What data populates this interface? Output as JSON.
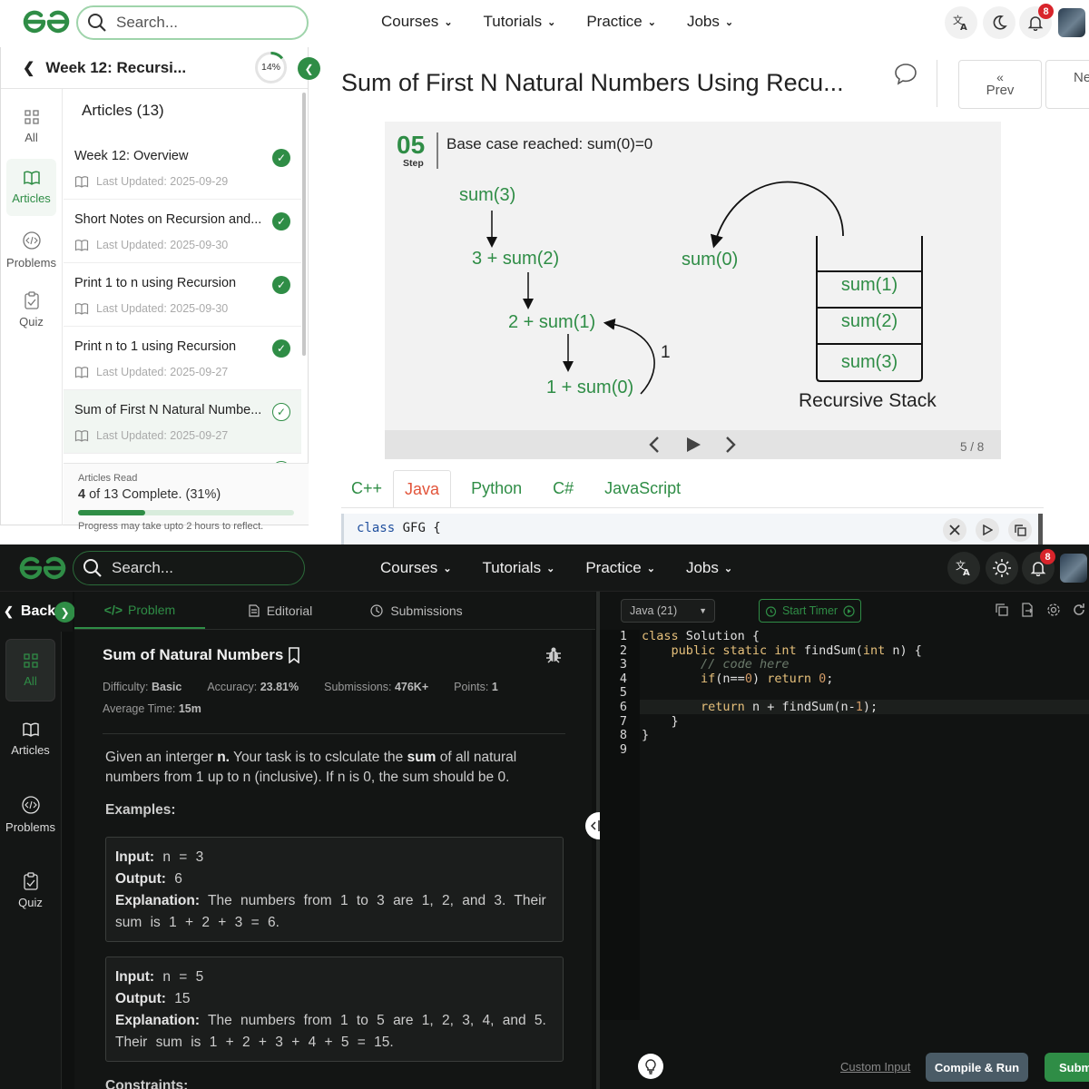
{
  "top": {
    "search_placeholder": "Search...",
    "nav": [
      "Courses",
      "Tutorials",
      "Practice",
      "Jobs"
    ],
    "notification_count": "8",
    "sidebar": {
      "back_title": "Week 12: Recursi...",
      "progress_label": "14%",
      "progress_value": 0.14,
      "rail": [
        {
          "label": "All",
          "icon": "grid-icon"
        },
        {
          "label": "Articles",
          "icon": "book-icon"
        },
        {
          "label": "Problems",
          "icon": "code-icon"
        },
        {
          "label": "Quiz",
          "icon": "clipboard-icon"
        }
      ],
      "section_title": "Articles (13)",
      "articles": [
        {
          "title": "Week 12: Overview",
          "updated": "Last Updated: 2025-09-29"
        },
        {
          "title": "Short Notes on Recursion and...",
          "updated": "Last Updated: 2025-09-30"
        },
        {
          "title": "Print 1 to n using Recursion",
          "updated": "Last Updated: 2025-09-30"
        },
        {
          "title": "Print n to 1 using Recursion",
          "updated": "Last Updated: 2025-09-27"
        },
        {
          "title": "Sum of First N Natural Numbe...",
          "updated": "Last Updated: 2025-09-27"
        }
      ],
      "articles_read_label": "Articles Read",
      "complete_count": "4",
      "complete_rest": "of 13 Complete. (31%)",
      "complete_value": 0.31,
      "progress_note": "Progress may take upto 2 hours to reflect."
    },
    "page_title": "Sum of First N Natural Numbers Using Recu...",
    "prev_label": "Prev",
    "next_label": "Ne",
    "slide": {
      "step_number": "05",
      "step_label": "Step",
      "caption": "Base case reached: sum(0)=0",
      "calls": [
        "sum(3)",
        "3 + sum(2)",
        "2 + sum(1)",
        "1 + sum(0)"
      ],
      "returned": "sum(0)",
      "return_value": "1",
      "stack": [
        "sum(1)",
        "sum(2)",
        "sum(3)"
      ],
      "stack_title": "Recursive Stack",
      "counter": "5 / 8"
    },
    "lang_tabs": [
      "C++",
      "Java",
      "Python",
      "C#",
      "JavaScript"
    ],
    "active_lang": "Java",
    "code_line": [
      "class",
      " GFG {"
    ]
  },
  "bottom": {
    "search_placeholder": "Search...",
    "nav": [
      "Courses",
      "Tutorials",
      "Practice",
      "Jobs"
    ],
    "notification_count": "8",
    "back_label": "Back",
    "tabs": [
      "Problem",
      "Editorial",
      "Submissions"
    ],
    "rail": [
      {
        "label": "All",
        "icon": "grid-icon"
      },
      {
        "label": "Articles",
        "icon": "book-icon"
      },
      {
        "label": "Problems",
        "icon": "code-icon"
      },
      {
        "label": "Quiz",
        "icon": "clipboard-icon"
      }
    ],
    "problem_title": "Sum of Natural Numbers",
    "meta": {
      "difficulty_label": "Difficulty:",
      "difficulty": "Basic",
      "accuracy_label": "Accuracy:",
      "accuracy": "23.81%",
      "submissions_label": "Submissions:",
      "submissions": "476K+",
      "points_label": "Points:",
      "points": "1",
      "avg_time_label": "Average Time:",
      "avg_time": "15m"
    },
    "statement": {
      "p1": "Given an interger ",
      "n": "n.",
      "p2": " Your task is to cslculate the ",
      "sum": "sum",
      "p3": " of all natural numbers from 1 up to n (inclusive). If n is 0, the sum should be 0."
    },
    "examples_heading": "Examples:",
    "examples": [
      {
        "input": "n = 3",
        "output": "6",
        "explanation": "The numbers from 1 to 3 are 1, 2, and 3. Their sum is 1 + 2 + 3 = 6."
      },
      {
        "input": "n = 5",
        "output": "15",
        "explanation": "The numbers from 1 to 5 are 1, 2, 3, 4, and 5. Their sum is 1 + 2 + 3 + 4 + 5 = 15."
      }
    ],
    "input_label": "Input:",
    "output_label": "Output:",
    "explanation_label": "Explanation:",
    "constraints_heading": "Constraints:",
    "language": "Java (21)",
    "start_timer": "Start Timer",
    "line_numbers": [
      "1",
      "2",
      "3",
      "4",
      "5",
      "6",
      "7",
      "8",
      "9"
    ],
    "custom_input": "Custom Input",
    "compile_run": "Compile & Run",
    "submit": "Submi"
  },
  "colors": {
    "brand_green": "#2f8d46",
    "dark_bg": "#0f1110",
    "badge_red": "#d8242b"
  }
}
